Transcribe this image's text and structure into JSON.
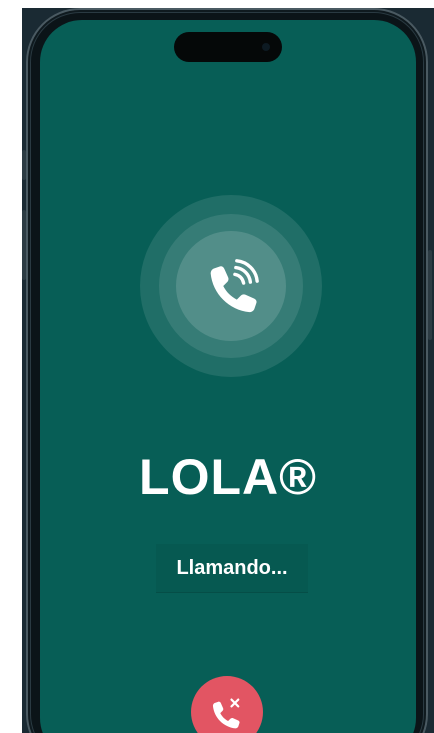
{
  "contact": {
    "name": "LOLA®",
    "status": "Llamando..."
  },
  "icons": {
    "call": "phone-ringing-icon",
    "end_call": "phone-missed-icon"
  },
  "colors": {
    "screen_background": "#075e56",
    "end_call_button": "#e25563",
    "text": "#ffffff"
  }
}
